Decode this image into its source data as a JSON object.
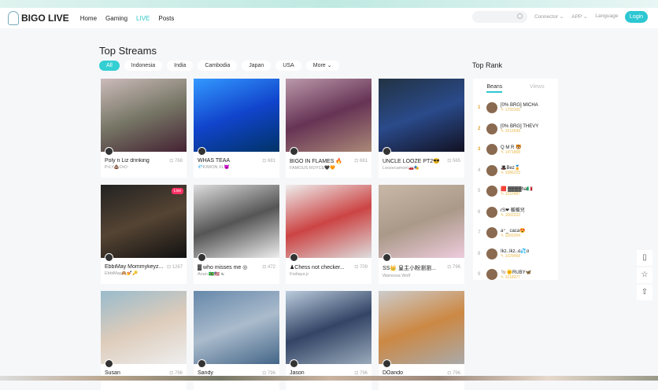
{
  "nav": {
    "logo": "BIGO LIVE",
    "links": [
      "Home",
      "Gaming",
      "LIVE",
      "Posts"
    ],
    "connector": "Connector ⌄",
    "app": "APP ⌄",
    "language": "Language",
    "login": "Login"
  },
  "main": {
    "title": "Top Streams",
    "filters": [
      "All",
      "Indonesia",
      "India",
      "Cambodia",
      "Japan",
      "USA",
      "More ⌄"
    ]
  },
  "cards": [
    {
      "title": "Poly n Liz drinking",
      "views": "768",
      "sub": "P•LY💩O•D",
      "bg": "linear-gradient(160deg,#cbb,#776,#423)"
    },
    {
      "title": "WHAS TEAA",
      "views": "681",
      "sub": "💎KIWON XL😈",
      "bg": "linear-gradient(160deg,#39f,#14c,#036)"
    },
    {
      "title": "BIGO IN FLAMES 🔥",
      "views": "661",
      "sub": "FAMOUS ROYCE🖤🧡",
      "bg": "linear-gradient(160deg,#b9a,#635,#a87)"
    },
    {
      "title": "UNCLE LOOZE PT2😎",
      "views": "565",
      "sub": "Loozecamont🚗🎭",
      "bg": "linear-gradient(160deg,#234,#2a4a8a,#112)"
    },
    {
      "title": "EbbiMay Mommykeyz...",
      "views": "1267",
      "sub": "EbbiMay🙈💅🔑",
      "bg": "linear-gradient(160deg,#222,#543,#111)",
      "live": "Live"
    },
    {
      "title": "▓ who misses me ◎",
      "views": "472",
      "sub": "Anan 🇧🇷🇺🇸 ☯",
      "bg": "linear-gradient(160deg,#ddd,#555,#eee)"
    },
    {
      "title": "♟Chess not checker...",
      "views": "709",
      "sub": "Fodiaya jr",
      "bg": "linear-gradient(160deg,#eee,#c44,#ddd)"
    },
    {
      "title": "SS👑 皇主小粉瀏瀏...",
      "views": "796",
      "sub": "Wanessa Wolf",
      "bg": "linear-gradient(160deg,#c9b8a8,#a98,#ecd)"
    },
    {
      "title": "Susan",
      "views": "796",
      "sub": "",
      "bg": "linear-gradient(160deg,#9bc,#dcb,#eee)"
    },
    {
      "title": "Sandy",
      "views": "796",
      "sub": "",
      "bg": "linear-gradient(160deg,#68a,#abc,#468)"
    },
    {
      "title": "Jason",
      "views": "796",
      "sub": "",
      "bg": "linear-gradient(160deg,#bcd,#346,#9ab)"
    },
    {
      "title": "DOando",
      "views": "796",
      "sub": "",
      "bg": "linear-gradient(160deg,#ccc,#c84,#aaa)"
    }
  ],
  "rank": {
    "title": "Top Rank",
    "tabs": [
      "Beans",
      "Views"
    ],
    "rows": [
      {
        "n": "1",
        "name": "[0% BRG] MICHA",
        "beans": "1793160"
      },
      {
        "n": "2",
        "name": "[0% BRG] THEVY",
        "beans": "1612649"
      },
      {
        "n": "3",
        "name": "Q M R 🐯",
        "beans": "1471868"
      },
      {
        "n": "4",
        "name": "🎩Bez🏅",
        "beans": "1086215"
      },
      {
        "n": "5",
        "name": "🟥 ▓▓▓▓ha🇮🇹",
        "beans": "1010487"
      },
      {
        "n": "6",
        "name": "rS❤ 暖暖兒",
        "beans": "1002022"
      },
      {
        "n": "7",
        "name": "a⁺_ caca😍",
        "beans": "1003254"
      },
      {
        "n": "8",
        "name": "Ikz..Ikz..ɑ💦ɑ",
        "beans": "1029458"
      },
      {
        "n": "9",
        "name": "🐚🌞RUBY🦋",
        "beans": "1018077"
      }
    ]
  },
  "side": [
    "▯",
    "☆",
    "⇧"
  ]
}
